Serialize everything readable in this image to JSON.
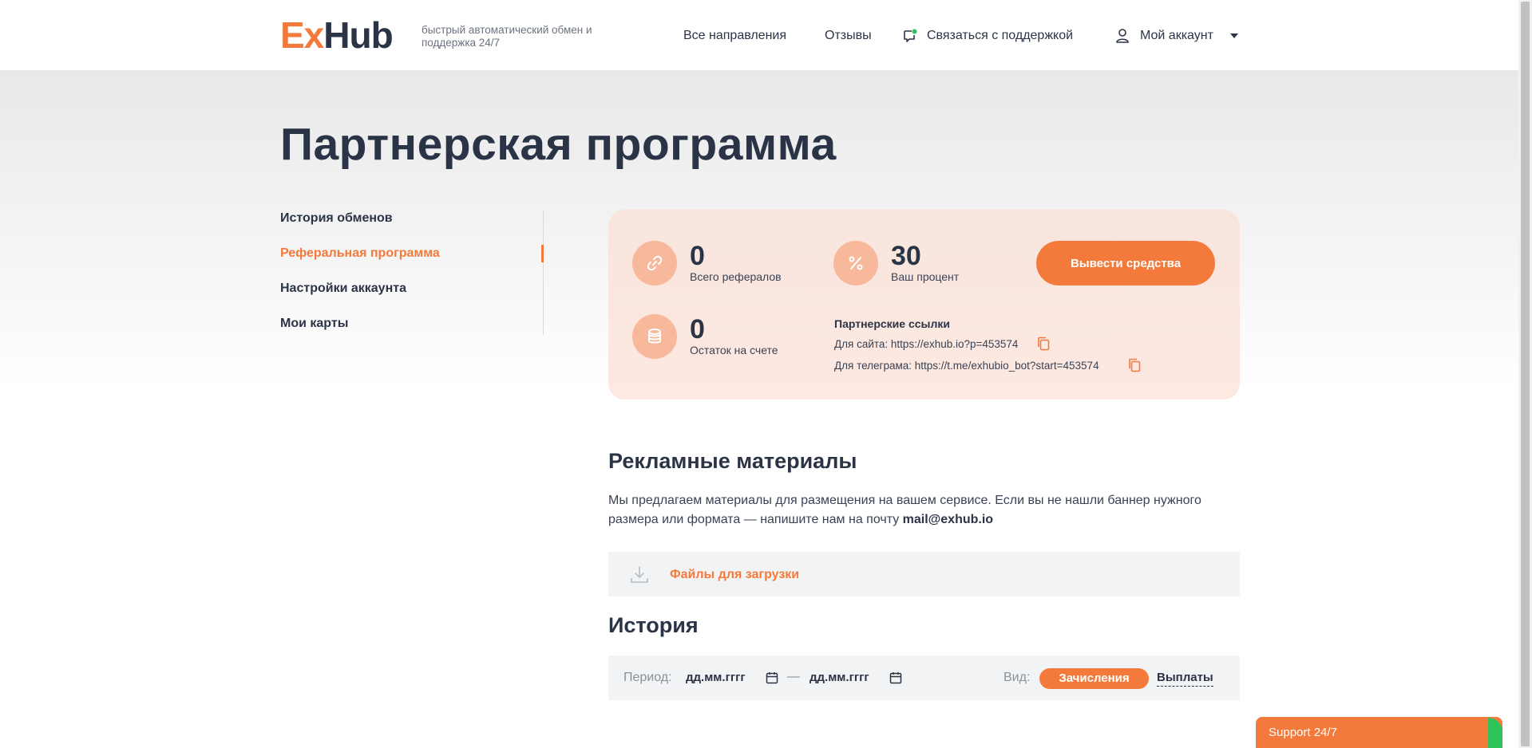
{
  "header": {
    "logo_ex": "Ex",
    "logo_hub": "Hub",
    "tagline": "быстрый автоматический обмен и поддержка 24/7",
    "nav": {
      "all_directions": "Все направления",
      "reviews": "Отзывы",
      "contact_support": "Связаться с поддержкой",
      "my_account": "Мой аккаунт"
    }
  },
  "page_title": "Партнерская программа",
  "sidebar": {
    "items": [
      {
        "label": "История обменов",
        "active": false
      },
      {
        "label": "Реферальная программа",
        "active": true
      },
      {
        "label": "Настройки аккаунта",
        "active": false
      },
      {
        "label": "Мои карты",
        "active": false
      }
    ]
  },
  "stats": {
    "referrals": {
      "value": "0",
      "label": "Всего рефералов",
      "icon": "link-icon"
    },
    "percent": {
      "value": "30",
      "label": "Ваш процент",
      "icon": "percent-icon"
    },
    "balance": {
      "value": "0",
      "label": "Остаток на счете",
      "icon": "coins-icon"
    },
    "withdraw_button": "Вывести средства"
  },
  "partner_links": {
    "title": "Партнерские ссылки",
    "site": "Для сайта: https://exhub.io?p=453574",
    "telegram": "Для телеграма: https://t.me/exhubio_bot?start=453574"
  },
  "promo": {
    "title": "Рекламные материалы",
    "text_before": "Мы предлагаем материалы для размещения на вашем сервисе. Если вы не нашли баннер нужного размера или формата — напишите нам на почту ",
    "email": "mail@exhub.io",
    "files_label": "Файлы для загрузки"
  },
  "history": {
    "title": "История",
    "period_label": "Период:",
    "date_from_placeholder": "дд.мм.гггг",
    "date_to_placeholder": "дд.мм.гггг",
    "dash": "—",
    "view_label": "Вид:",
    "tab_credits": "Зачисления",
    "tab_payouts": "Выплаты"
  },
  "support_widget": "Support 24/7",
  "colors": {
    "accent": "#f47a3b",
    "text_dark": "#2b3447",
    "card_bg": "#f8e5dd",
    "icon_circle": "#f7b89b",
    "online": "#2ec25a"
  }
}
